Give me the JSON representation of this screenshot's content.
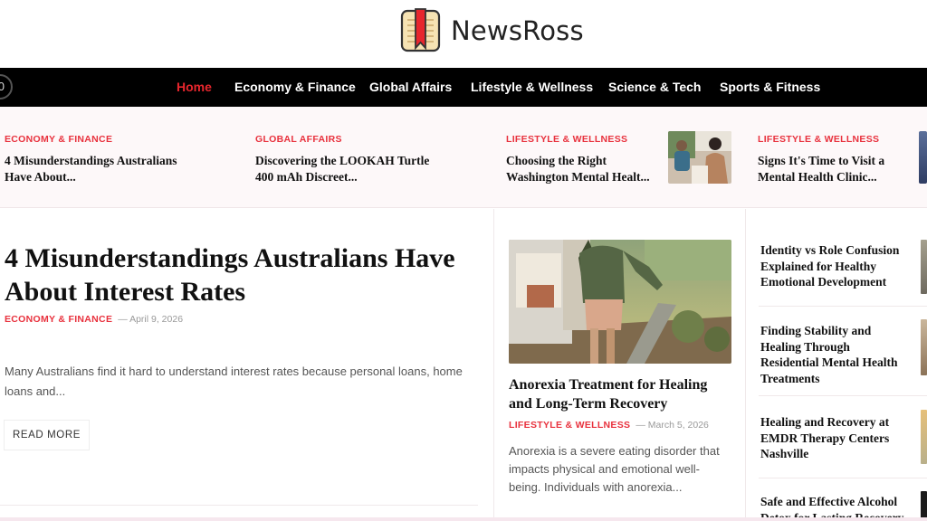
{
  "brand": {
    "name": "NewsRoss",
    "accent": "#e8262d"
  },
  "nav": {
    "items": [
      {
        "label": "Home",
        "active": true
      },
      {
        "label": "Economy & Finance"
      },
      {
        "label": "Global Affairs"
      },
      {
        "label": "Lifestyle & Wellness"
      },
      {
        "label": "Science & Tech"
      },
      {
        "label": "Sports & Fitness"
      }
    ]
  },
  "ticker": [
    {
      "category": "ECONOMY & FINANCE",
      "title": "4 Misunderstandings Australians Have About..."
    },
    {
      "category": "GLOBAL AFFAIRS",
      "title": "Discovering the LOOKAH Turtle 400 mAh Discreet..."
    },
    {
      "category": "LIFESTYLE & WELLNESS",
      "title": "Choosing the Right Washington Mental Healt..."
    },
    {
      "category": "LIFESTYLE & WELLNESS",
      "title": "Signs It's Time to Visit a Mental Health Clinic..."
    }
  ],
  "lead": {
    "title": "4 Misunderstandings Australians Have About Interest Rates",
    "category": "ECONOMY & FINANCE",
    "date": "— April 9, 2026",
    "excerpt": "Many Australians find it hard to understand interest rates because personal loans, home loans and...",
    "read_more": "READ MORE"
  },
  "card": {
    "title": "Anorexia Treatment for Healing and Long-Term Recovery",
    "category": "LIFESTYLE & WELLNESS",
    "date": "— March 5, 2026",
    "excerpt": "Anorexia is a severe eating disorder that impacts physical and emotional well-being. Individuals with anorexia..."
  },
  "sidebar": [
    {
      "title": "Identity vs Role Confusion Explained for Healthy Emotional Development"
    },
    {
      "title": "Finding Stability and Healing Through Residential Mental Health Treatments"
    },
    {
      "title": "Healing and Recovery at EMDR Therapy Centers Nashville"
    },
    {
      "title": "Safe and Effective Alcohol Detox for Lasting Recovery"
    }
  ]
}
